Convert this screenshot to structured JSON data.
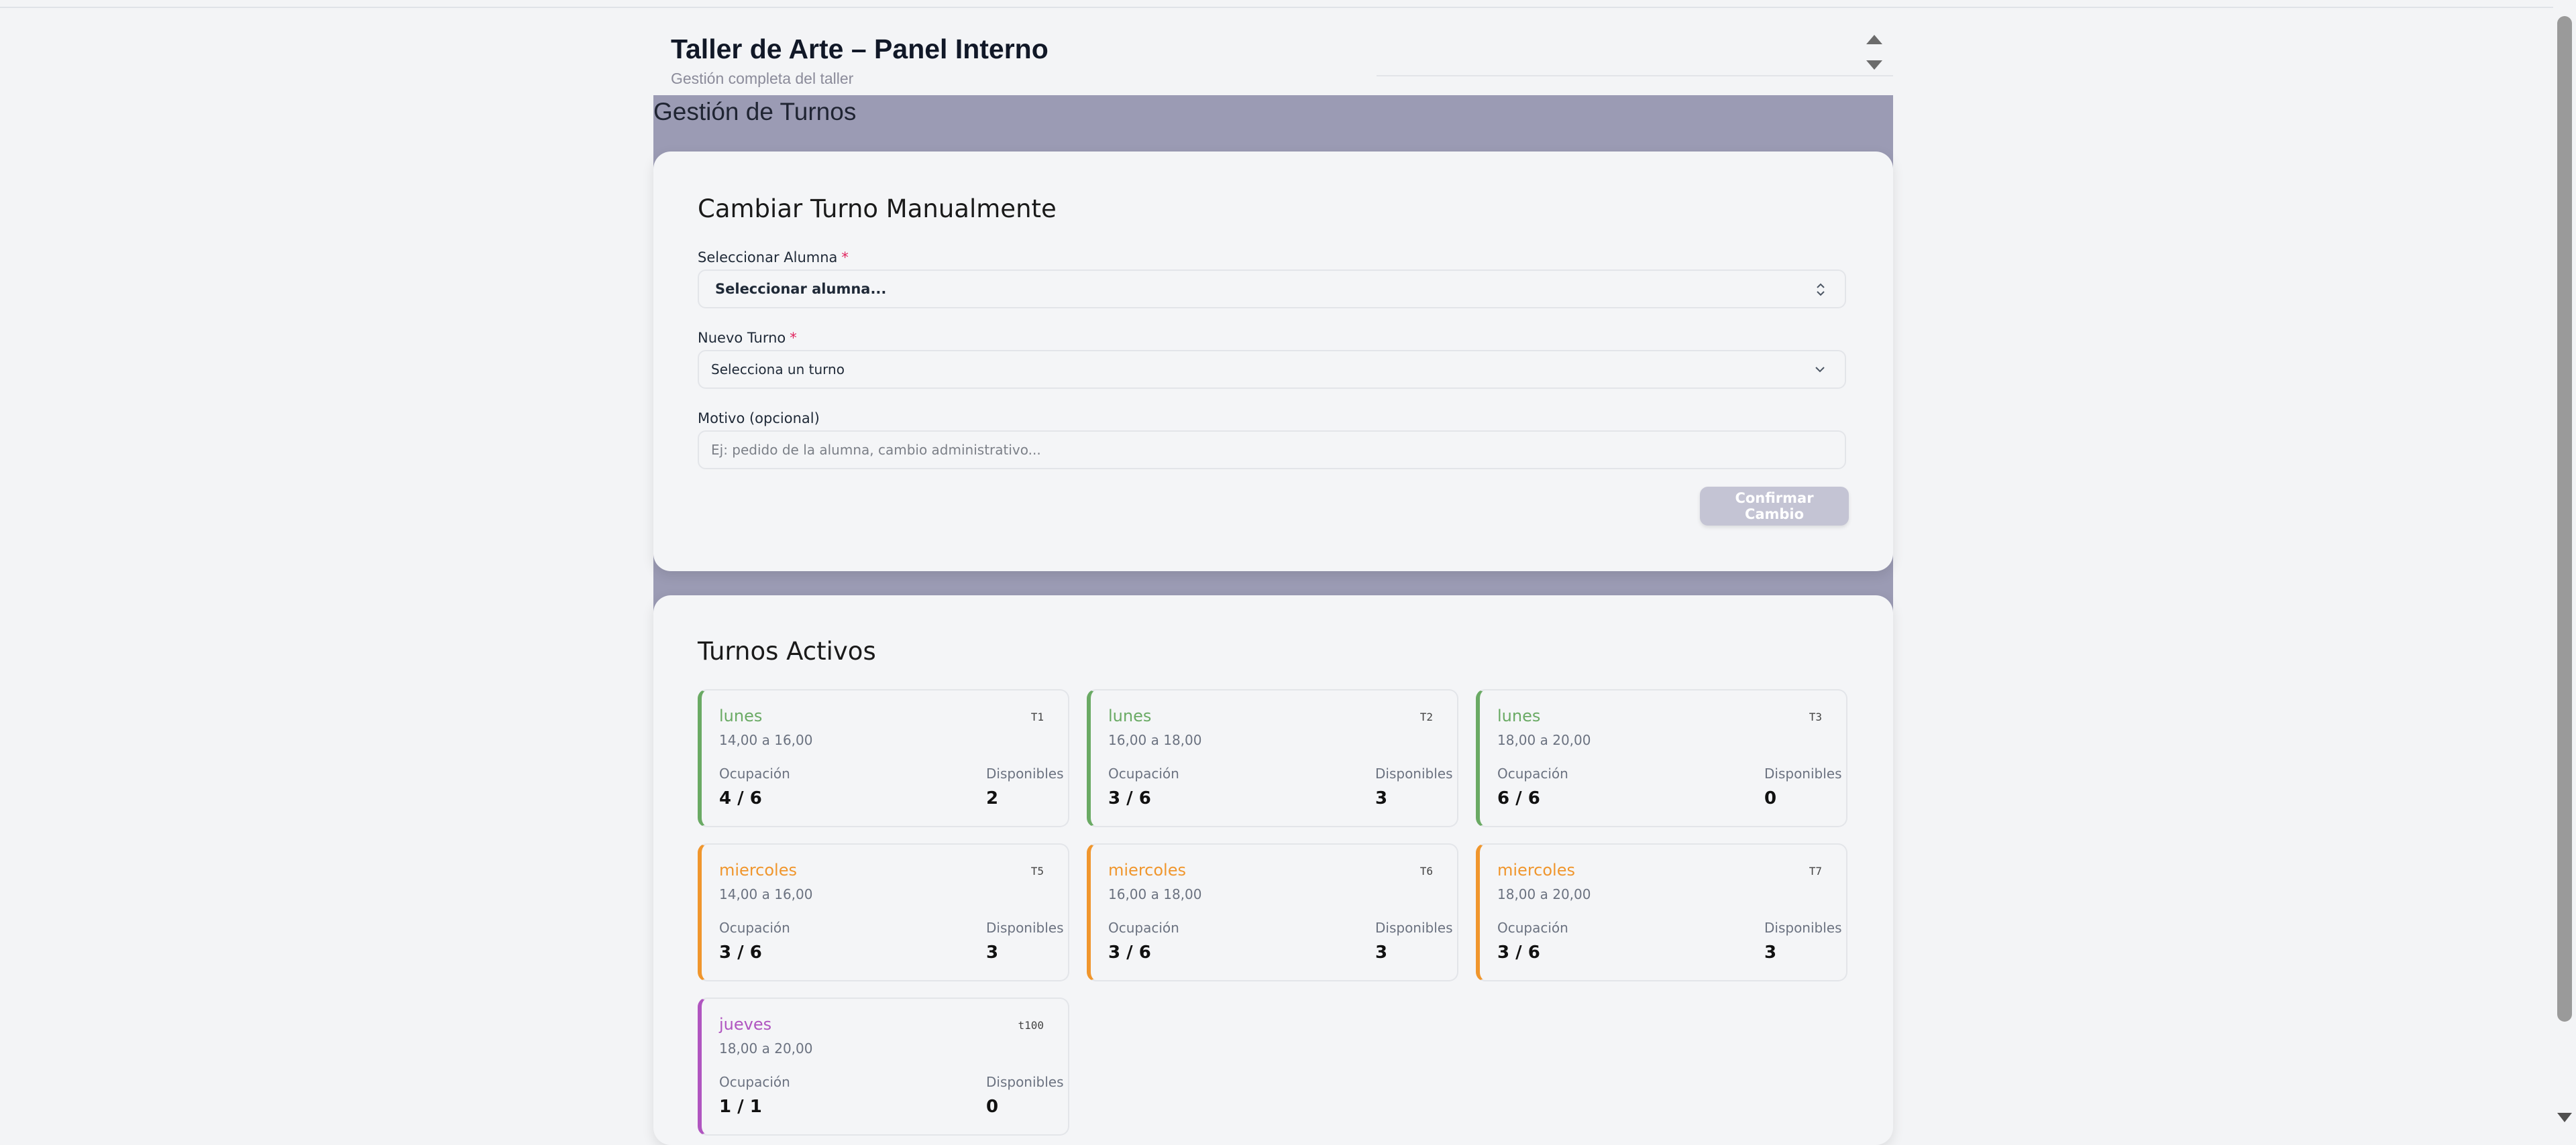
{
  "header": {
    "title": "Taller de Arte – Panel Interno",
    "subtitle": "Gestión completa del taller"
  },
  "main": {
    "page_title": "Gestión de Turnos"
  },
  "change_form": {
    "title": "Cambiar Turno Manualmente",
    "student_label": "Seleccionar Alumna",
    "student_value": "Seleccionar alumna...",
    "shift_label": "Nuevo Turno",
    "shift_value": "Selecciona un turno",
    "reason_label": "Motivo (opcional)",
    "reason_placeholder": "Ej: pedido de la alumna, cambio administrativo...",
    "required_mark": "*",
    "confirm_label": "Confirmar Cambio"
  },
  "active_shifts": {
    "title": "Turnos Activos",
    "occupancy_label": "Ocupación",
    "available_label": "Disponibles",
    "colors": {
      "lunes": "#6aaa64",
      "miercoles": "#f0962d",
      "jueves": "#b055c0"
    },
    "items": [
      {
        "day": "lunes",
        "code": "T1",
        "time": "14,00 a 16,00",
        "occupancy": "4 / 6",
        "available": "2"
      },
      {
        "day": "lunes",
        "code": "T2",
        "time": "16,00 a 18,00",
        "occupancy": "3 / 6",
        "available": "3"
      },
      {
        "day": "lunes",
        "code": "T3",
        "time": "18,00 a 20,00",
        "occupancy": "6 / 6",
        "available": "0"
      },
      {
        "day": "miercoles",
        "code": "T5",
        "time": "14,00 a 16,00",
        "occupancy": "3 / 6",
        "available": "3"
      },
      {
        "day": "miercoles",
        "code": "T6",
        "time": "16,00 a 18,00",
        "occupancy": "3 / 6",
        "available": "3"
      },
      {
        "day": "miercoles",
        "code": "T7",
        "time": "18,00 a 20,00",
        "occupancy": "3 / 6",
        "available": "3"
      },
      {
        "day": "jueves",
        "code": "t100",
        "time": "18,00 a 20,00",
        "occupancy": "1 / 1",
        "available": "0"
      }
    ]
  }
}
